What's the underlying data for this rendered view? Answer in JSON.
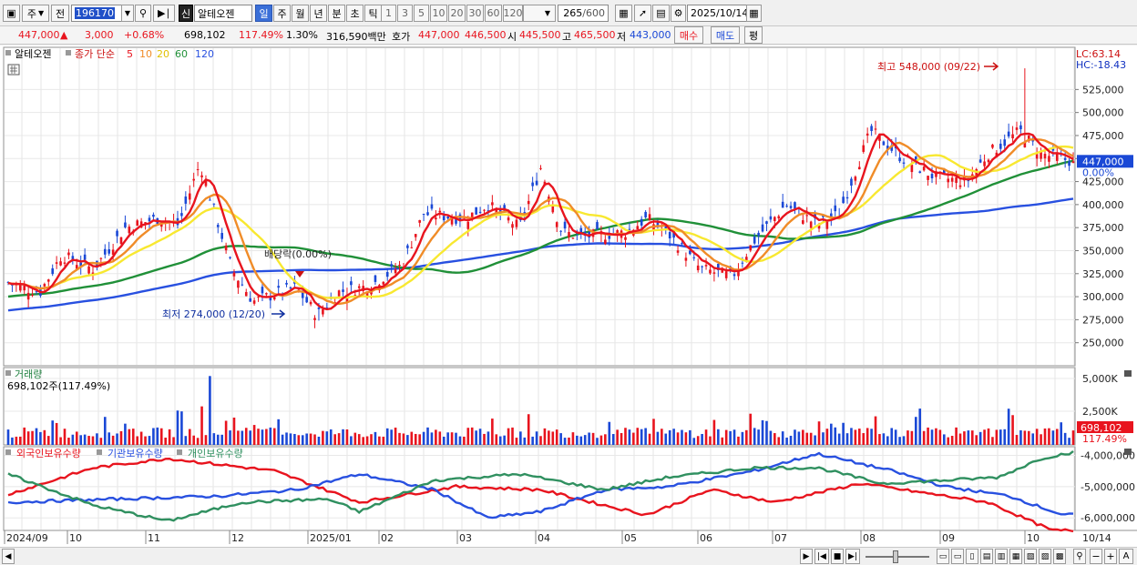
{
  "toolbar": {
    "period_type": "주",
    "prefix": "전",
    "code": "196170",
    "new_badge": "신",
    "stock_name": "알테오젠",
    "timeframes": [
      "일",
      "주",
      "월",
      "년",
      "분",
      "초",
      "틱"
    ],
    "intervals": [
      "1",
      "3",
      "5",
      "10",
      "20",
      "30",
      "60",
      "120"
    ],
    "count": "265",
    "count_total": "/600",
    "date": "2025/10/14"
  },
  "quote": {
    "price": "447,000",
    "change_arrow": "▲",
    "change": "3,000",
    "change_pct": "+0.68%",
    "volume": "698,102",
    "vol_ratio": "117.49%",
    "turnover": "1.30%",
    "amount": "316,590백만",
    "bid_label": "호가",
    "bid1": "447,000",
    "bid2": "446,500",
    "open_label": "시",
    "open": "445,500",
    "high_label": "고",
    "high": "465,500",
    "low_label": "저",
    "low": "443,000",
    "buy_label": "매수",
    "sell_label": "매도",
    "eval_label": "평"
  },
  "price_panel": {
    "name": "알테오젠",
    "ma_title": "종가 단순",
    "ma_periods": [
      "5",
      "10",
      "20",
      "60",
      "120"
    ],
    "lc": "LC:63.14",
    "hc": "HC:-18.43",
    "y_ticks": [
      "525,000",
      "500,000",
      "475,000",
      "450,000",
      "425,000",
      "400,000",
      "375,000",
      "350,000",
      "325,000",
      "300,000",
      "275,000",
      "250,000"
    ],
    "current_price": "447,000",
    "current_pct": "0.00%",
    "max_label": "최고 548,000 (09/22)",
    "min_label": "최저 274,000 (12/20)",
    "dividend_label": "배당락(0.00%)"
  },
  "volume_panel": {
    "title": "거래량",
    "value": "698,102주(117.49%)",
    "y_ticks": [
      "5,000K",
      "2,500K"
    ],
    "current": "698,102",
    "current_pct": "117.49%"
  },
  "investor_panel": {
    "series": [
      "외국인보유수량",
      "기관보유수량",
      "개인보유수량"
    ],
    "y_ticks": [
      "-4,000,000",
      "-5,000,000",
      "-6,000,000"
    ]
  },
  "x_labels": [
    "2024/09",
    "10",
    "11",
    "12",
    "2025/01",
    "02",
    "03",
    "04",
    "05",
    "06",
    "07",
    "08",
    "09",
    "10"
  ],
  "x_right_label": "10/14",
  "colors": {
    "up": "#e8141e",
    "down": "#1a48d6",
    "ma5": "#e8141e",
    "ma10": "#f08c28",
    "ma20": "#f8e830",
    "ma60": "#209038",
    "ma120": "#2850e0",
    "foreign": "#e8141e",
    "inst": "#2850e0",
    "retail": "#309060"
  },
  "chart_data": [
    {
      "type": "candlestick",
      "title": "알테오젠",
      "ylim": [
        225000,
        555000
      ],
      "x": [
        "2024/09",
        "10",
        "11",
        "12",
        "2025/01",
        "02",
        "03",
        "04",
        "05",
        "06",
        "07",
        "08",
        "09",
        "10"
      ],
      "close_anchors": [
        [
          "2024/09",
          315000
        ],
        [
          "10",
          375000
        ],
        [
          "11",
          385000
        ],
        [
          "11(late)",
          445000
        ],
        [
          "12",
          300000
        ],
        [
          "12/20",
          280000
        ],
        [
          "2025/01",
          310000
        ],
        [
          "02",
          375000
        ],
        [
          "03",
          390000
        ],
        [
          "03(mid)",
          440000
        ],
        [
          "04",
          365000
        ],
        [
          "04(mid)",
          385000
        ],
        [
          "05",
          345000
        ],
        [
          "05(late)",
          320000
        ],
        [
          "06",
          360000
        ],
        [
          "06(mid)",
          395000
        ],
        [
          "07",
          385000
        ],
        [
          "07(mid)",
          470000
        ],
        [
          "08",
          440000
        ],
        [
          "08(mid)",
          430000
        ],
        [
          "09",
          450000
        ],
        [
          "09/22",
          500000
        ],
        [
          "10",
          455000
        ],
        [
          "10/14",
          447000
        ]
      ],
      "max": {
        "value": 548000,
        "date": "09/22"
      },
      "min": {
        "value": 274000,
        "date": "12/20"
      },
      "series": [
        {
          "name": "5",
          "color": "#e8141e"
        },
        {
          "name": "10",
          "color": "#f08c28"
        },
        {
          "name": "20",
          "color": "#f8e830"
        },
        {
          "name": "60",
          "color": "#209038"
        },
        {
          "name": "120",
          "color": "#2850e0"
        }
      ]
    },
    {
      "type": "bar",
      "title": "거래량",
      "ylim": [
        0,
        6000000
      ]
    },
    {
      "type": "line",
      "ylim": [
        -6400000,
        -3900000
      ],
      "series": [
        {
          "name": "외국인보유수량",
          "color": "#e8141e",
          "anchors": [
            [
              0,
              -5250000
            ],
            [
              0.08,
              -4400000
            ],
            [
              0.15,
              -4100000
            ],
            [
              0.25,
              -4500000
            ],
            [
              0.33,
              -5500000
            ],
            [
              0.42,
              -5000000
            ],
            [
              0.5,
              -5100000
            ],
            [
              0.56,
              -5600000
            ],
            [
              0.6,
              -5900000
            ],
            [
              0.66,
              -5100000
            ],
            [
              0.72,
              -5500000
            ],
            [
              0.8,
              -4900000
            ],
            [
              0.86,
              -5200000
            ],
            [
              0.92,
              -5500000
            ],
            [
              0.98,
              -6400000
            ]
          ]
        },
        {
          "name": "기관보유수량",
          "color": "#2850e0",
          "anchors": [
            [
              0,
              -5500000
            ],
            [
              0.1,
              -5400000
            ],
            [
              0.2,
              -5300000
            ],
            [
              0.27,
              -5100000
            ],
            [
              0.33,
              -4600000
            ],
            [
              0.4,
              -5100000
            ],
            [
              0.45,
              -6000000
            ],
            [
              0.5,
              -5800000
            ],
            [
              0.56,
              -5100000
            ],
            [
              0.62,
              -5000000
            ],
            [
              0.7,
              -4500000
            ],
            [
              0.76,
              -3950000
            ],
            [
              0.83,
              -4500000
            ],
            [
              0.88,
              -5000000
            ],
            [
              0.94,
              -5300000
            ],
            [
              0.99,
              -5900000
            ]
          ]
        },
        {
          "name": "개인보유수량",
          "color": "#309060",
          "anchors": [
            [
              0,
              -4600000
            ],
            [
              0.08,
              -5600000
            ],
            [
              0.15,
              -6100000
            ],
            [
              0.22,
              -5500000
            ],
            [
              0.3,
              -5400000
            ],
            [
              0.33,
              -5800000
            ],
            [
              0.4,
              -4800000
            ],
            [
              0.48,
              -4600000
            ],
            [
              0.56,
              -5100000
            ],
            [
              0.62,
              -4700000
            ],
            [
              0.7,
              -4400000
            ],
            [
              0.76,
              -4400000
            ],
            [
              0.82,
              -4900000
            ],
            [
              0.88,
              -4800000
            ],
            [
              0.93,
              -4700000
            ],
            [
              0.97,
              -4100000
            ],
            [
              1.0,
              -3900000
            ]
          ]
        }
      ]
    }
  ]
}
